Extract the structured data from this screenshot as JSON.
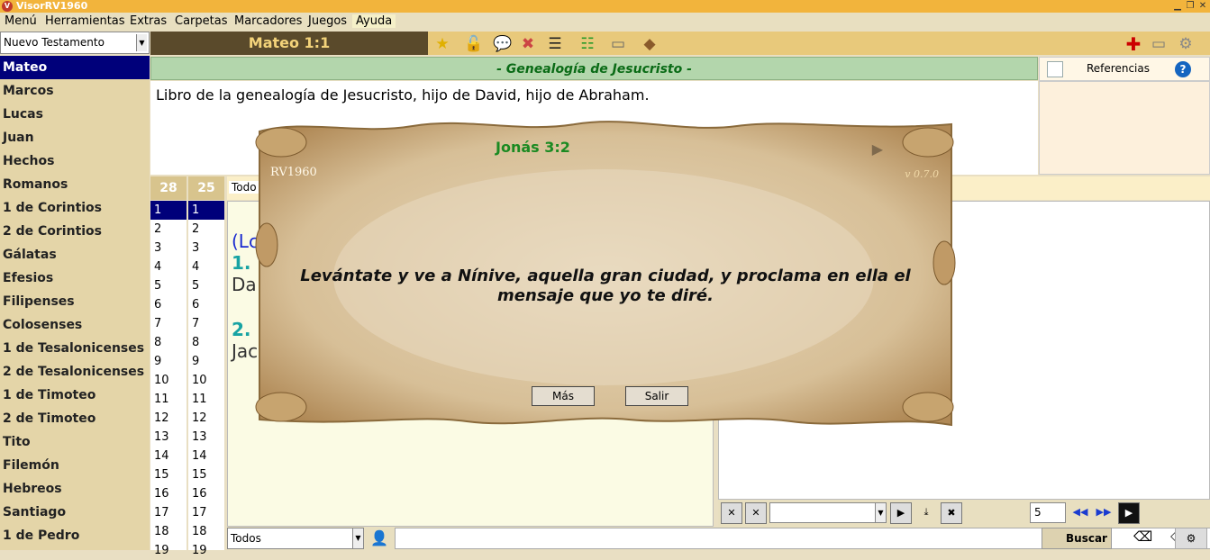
{
  "window": {
    "title": "VisorRV1960"
  },
  "menu": [
    "Menú",
    "Herramientas",
    "Extras",
    "Carpetas",
    "Marcadores",
    "Juegos",
    "Ayuda"
  ],
  "book_selector": {
    "value": "Nuevo Testamento"
  },
  "current_ref": "Mateo 1:1",
  "books": [
    "Mateo",
    "Marcos",
    "Lucas",
    "Juan",
    "Hechos",
    "Romanos",
    "1 de Corintios",
    "2 de Corintios",
    "Gálatas",
    "Efesios",
    "Filipenses",
    "Colosenses",
    "1 de Tesalonicenses",
    "2 de Tesalonicenses",
    "1 de Timoteo",
    "2 de Timoteo",
    "Tito",
    "Filemón",
    "Hebreos",
    "Santiago",
    "1 de Pedro"
  ],
  "active_book": "Mateo",
  "section_heading": "- Genealogía de Jesucristo -",
  "verse_text": "Libro de la genealogía de Jesucristo, hijo de David, hijo de Abraham.",
  "references": {
    "label": "Referencias"
  },
  "chapter_count": "28",
  "verse_count": "25",
  "chapter_numbers": [
    "1",
    "2",
    "3",
    "4",
    "5",
    "6",
    "7",
    "8",
    "9",
    "10",
    "11",
    "12",
    "13",
    "14",
    "15",
    "16",
    "17",
    "18",
    "19"
  ],
  "verse_numbers": [
    "1",
    "2",
    "3",
    "4",
    "5",
    "6",
    "7",
    "8",
    "9",
    "10",
    "11",
    "12",
    "13",
    "14",
    "15",
    "16",
    "17",
    "18",
    "19"
  ],
  "todos_label": "Todo",
  "text_fragments": {
    "f1": "(Lc",
    "f2": "1.",
    "f3": "Da",
    "f4": "2.",
    "f5": "Jac"
  },
  "right_tools": {
    "spin_value": "5"
  },
  "bottom": {
    "filter": "Todos",
    "search_button": "Buscar"
  },
  "popup": {
    "reference": "Jonás 3:2",
    "version": "RV1960",
    "build": "v 0.7.0",
    "verse": "Levántate y ve a Nínive, aquella gran ciudad, y proclama en ella el mensaje que yo te diré.",
    "more_button": "Más",
    "exit_button": "Salir"
  },
  "colors": {
    "accent_navy": "#00007a",
    "heading_green": "#0a6b16",
    "toolbar": "#e8c97b",
    "titlebar": "#f2b43c"
  },
  "icons": [
    "star-add-icon",
    "unlock-icon",
    "chat-icon",
    "book-remove-icon",
    "list-icon",
    "tree-list-icon",
    "monitor-icon",
    "bookmark-icon",
    "add-icon",
    "monitor-small-icon",
    "settings-icon"
  ]
}
